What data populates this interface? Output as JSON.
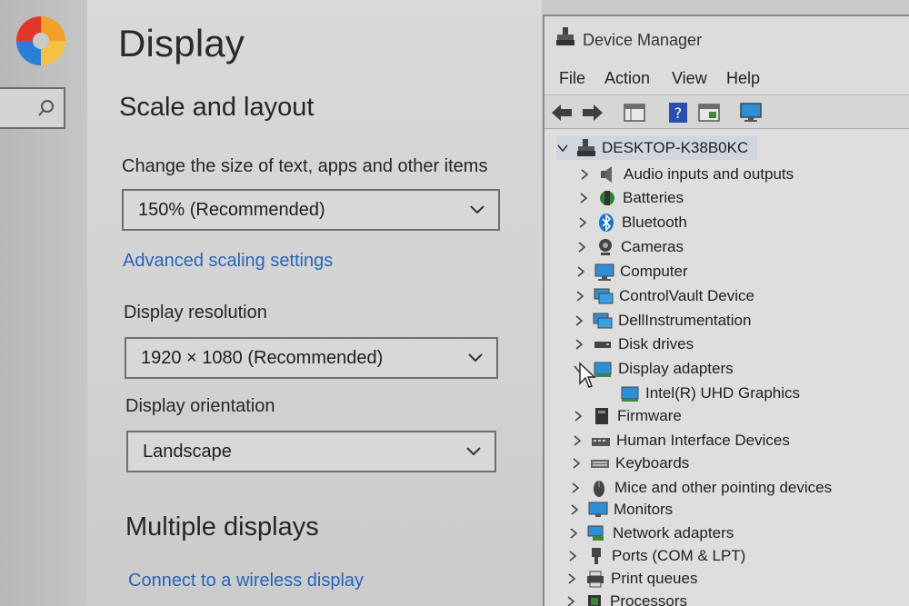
{
  "settings": {
    "page_title": "Display",
    "scale_section_title": "Scale and layout",
    "scale_label": "Change the size of text, apps and other items",
    "scale_value": "150% (Recommended)",
    "advanced_scaling_link": "Advanced scaling settings",
    "resolution_label": "Display resolution",
    "resolution_value": "1920 × 1080 (Recommended)",
    "orientation_label": "Display orientation",
    "orientation_value": "Landscape",
    "multiple_displays_title": "Multiple displays",
    "wireless_link": "Connect to a wireless display"
  },
  "device_manager": {
    "title": "Device Manager",
    "menu": [
      "File",
      "Action",
      "View",
      "Help"
    ],
    "toolbar_icons": [
      "back-arrow-icon",
      "forward-arrow-icon",
      "properties-icon",
      "help-icon",
      "update-driver-icon",
      "monitor-scan-icon"
    ],
    "root": "DESKTOP-K38B0KC",
    "categories": [
      {
        "label": "Audio inputs and outputs",
        "icon": "speaker-icon"
      },
      {
        "label": "Batteries",
        "icon": "battery-icon"
      },
      {
        "label": "Bluetooth",
        "icon": "bluetooth-icon"
      },
      {
        "label": "Cameras",
        "icon": "camera-icon"
      },
      {
        "label": "Computer",
        "icon": "computer-icon"
      },
      {
        "label": "ControlVault Device",
        "icon": "device-icon"
      },
      {
        "label": "DellInstrumentation",
        "icon": "device-icon"
      },
      {
        "label": "Disk drives",
        "icon": "disk-icon"
      },
      {
        "label": "Display adapters",
        "icon": "display-adapter-icon",
        "expanded": true
      },
      {
        "label": "Intel(R) UHD Graphics",
        "icon": "display-adapter-icon",
        "child": true
      },
      {
        "label": "Firmware",
        "icon": "firmware-icon"
      },
      {
        "label": "Human Interface Devices",
        "icon": "hid-icon"
      },
      {
        "label": "Keyboards",
        "icon": "keyboard-icon"
      },
      {
        "label": "Mice and other pointing devices",
        "icon": "mouse-icon"
      },
      {
        "label": "Monitors",
        "icon": "monitor-icon"
      },
      {
        "label": "Network adapters",
        "icon": "network-icon"
      },
      {
        "label": "Ports (COM & LPT)",
        "icon": "port-icon"
      },
      {
        "label": "Print queues",
        "icon": "printer-icon"
      },
      {
        "label": "Processors",
        "icon": "processor-icon"
      }
    ]
  },
  "colors": {
    "link": "#2b63b5",
    "accent_blue": "#1a73c8"
  }
}
